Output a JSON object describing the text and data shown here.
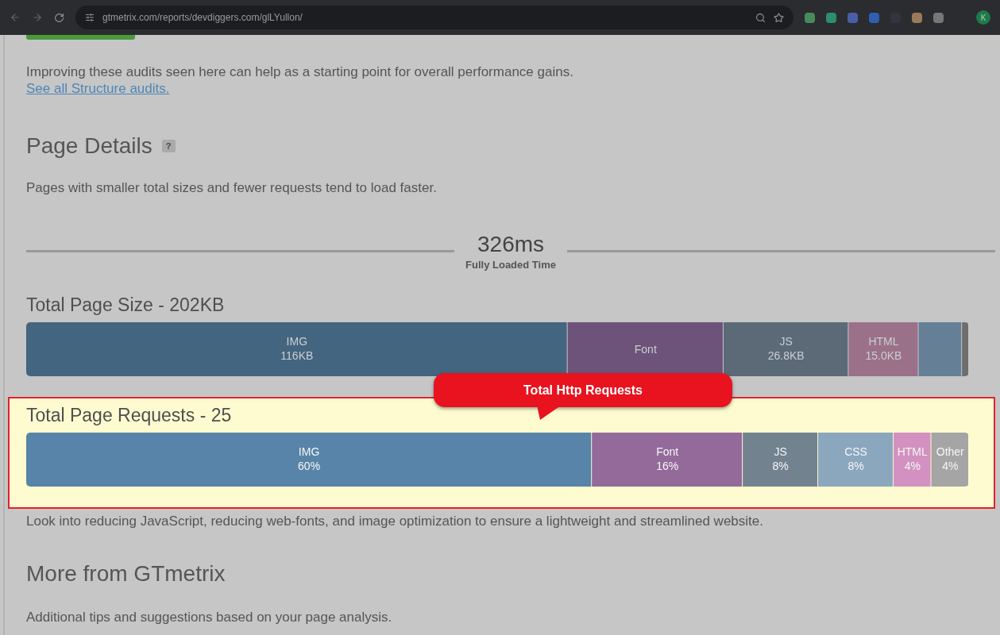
{
  "browser": {
    "url": "gtmetrix.com/reports/devdiggers.com/glLYullon/",
    "profile_initial": "K"
  },
  "structure": {
    "intro": "Improving these audits seen here can help as a starting point for overall performance gains.",
    "link": "See all Structure audits."
  },
  "page_details": {
    "title": "Page Details",
    "help": "?",
    "description": "Pages with smaller total sizes and fewer requests tend to load faster.",
    "timeline": {
      "value": "326ms",
      "label": "Fully Loaded Time"
    },
    "size": {
      "title": "Total Page Size - 202KB",
      "chart_data": {
        "type": "bar",
        "orientation": "horizontal",
        "stacked": true,
        "categories": [
          null
        ],
        "series": [
          {
            "name": "IMG",
            "color": "#44657f",
            "values": [
              116
            ],
            "value_labels": [
              "116KB"
            ]
          },
          {
            "name": "Font",
            "color": "#6d5379",
            "values": [
              33.4
            ],
            "value_labels": [
              null
            ]
          },
          {
            "name": "JS",
            "color": "#5b6a76",
            "values": [
              26.8
            ],
            "value_labels": [
              "26.8KB"
            ]
          },
          {
            "name": "HTML",
            "color": "#9b7189",
            "values": [
              15.0
            ],
            "value_labels": [
              "15.0KB"
            ]
          },
          {
            "color": "#657f96",
            "values": [
              9.3
            ],
            "value_labels": [
              null
            ]
          },
          {
            "color": "#6e6e6e",
            "values": [
              1.5
            ],
            "value_labels": [
              null
            ]
          }
        ]
      }
    },
    "callout": "Total Http Requests",
    "requests": {
      "title": "Total Page Requests - 25",
      "highlighted": true,
      "chart_data": {
        "type": "bar",
        "orientation": "horizontal",
        "stacked": true,
        "categories": [
          null
        ],
        "series": [
          {
            "name": "IMG",
            "color": "#5784a8",
            "values": [
              60
            ],
            "value_labels": [
              "60%"
            ]
          },
          {
            "name": "Font",
            "color": "#936a9a",
            "values": [
              16
            ],
            "value_labels": [
              "16%"
            ]
          },
          {
            "name": "JS",
            "color": "#72828f",
            "values": [
              8
            ],
            "value_labels": [
              "8%"
            ]
          },
          {
            "name": "CSS",
            "color": "#8aa7be",
            "values": [
              8
            ],
            "value_labels": [
              "8%"
            ]
          },
          {
            "name": "HTML",
            "color": "#d291c0",
            "values": [
              4
            ],
            "value_labels": [
              "4%"
            ]
          },
          {
            "name": "Other",
            "color": "#a5a5a5",
            "values": [
              4
            ],
            "value_labels": [
              "4%"
            ]
          }
        ]
      }
    },
    "note": "Look into reducing JavaScript, reducing web-fonts, and image optimization to ensure a lightweight and streamlined website."
  },
  "more": {
    "title": "More from GTmetrix",
    "description": "Additional tips and suggestions based on your page analysis."
  }
}
